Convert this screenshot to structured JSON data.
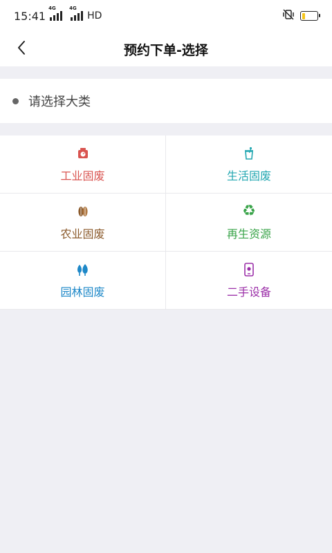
{
  "status_bar": {
    "time": "15:41",
    "signal_1_net": "4G",
    "signal_2_net": "4G",
    "hd_label": "HD",
    "battery_level": 0.2
  },
  "nav": {
    "back_icon": "chevron-left-icon",
    "title": "预约下单-选择"
  },
  "section": {
    "label": "请选择大类"
  },
  "categories": [
    {
      "label": "工业固废",
      "icon": "scale-icon",
      "color": "#d9534f"
    },
    {
      "label": "生活固废",
      "icon": "trash-bin-icon",
      "color": "#20a6b0"
    },
    {
      "label": "农业固废",
      "icon": "grain-icon",
      "color": "#8b5a2b"
    },
    {
      "label": "再生资源",
      "icon": "recycle-icon",
      "color": "#3aa44a"
    },
    {
      "label": "园林固废",
      "icon": "trees-icon",
      "color": "#1e88c8"
    },
    {
      "label": "二手设备",
      "icon": "phone-icon",
      "color": "#9b2fa8"
    }
  ]
}
